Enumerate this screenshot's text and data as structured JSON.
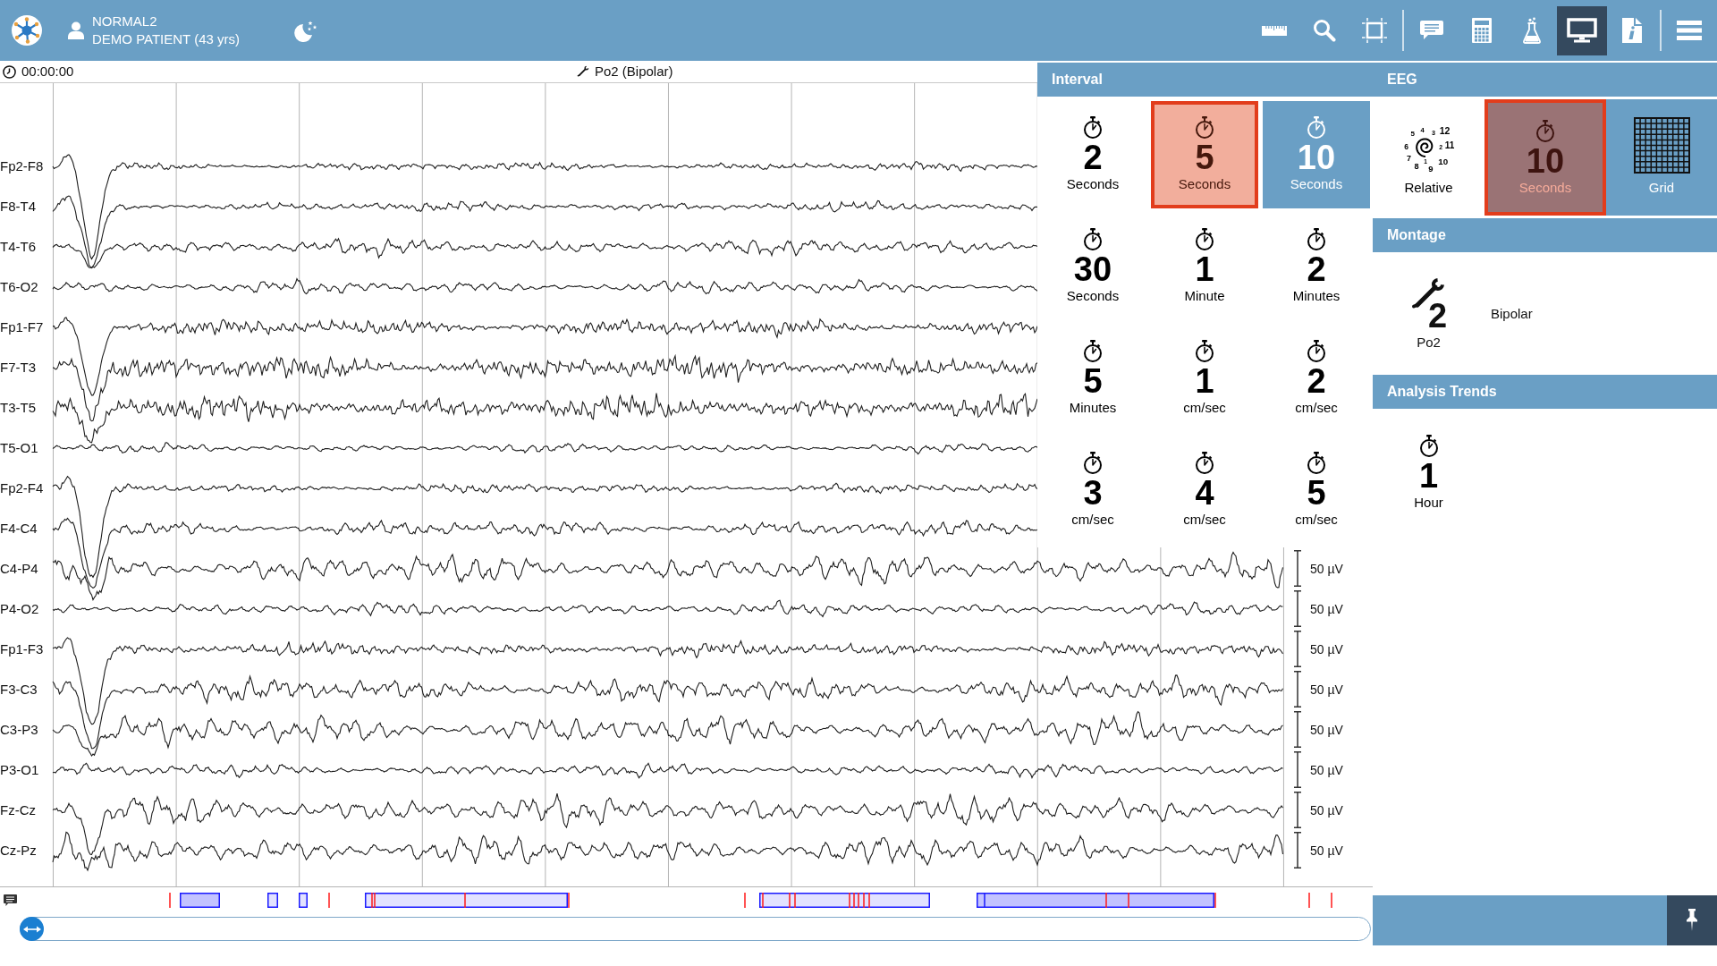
{
  "top_bar": {
    "record_name": "NORMAL2",
    "patient_name": "DEMO PATIENT (43 yrs)",
    "toolbar": [
      {
        "tools": [
          {
            "kind": "ruler",
            "selected": false
          },
          {
            "kind": "search",
            "selected": false
          },
          {
            "kind": "crop",
            "selected": false
          }
        ]
      },
      {
        "tools": [
          {
            "kind": "chat",
            "selected": false
          },
          {
            "kind": "calculator",
            "selected": false
          },
          {
            "kind": "flask",
            "selected": false
          },
          {
            "kind": "monitor",
            "selected": true
          },
          {
            "kind": "info",
            "selected": false
          }
        ]
      },
      {
        "tools": [
          {
            "kind": "menu",
            "selected": false
          }
        ]
      }
    ]
  },
  "eeg_view": {
    "elapsed_time": "00:00:00",
    "montage_title": "Po2 (Bipolar)",
    "channels": [
      {
        "label": "Fp2-F8"
      },
      {
        "label": "F8-T4"
      },
      {
        "label": "T4-T6"
      },
      {
        "label": "T6-O2"
      },
      {
        "label": "Fp1-F7"
      },
      {
        "label": "F7-T3"
      },
      {
        "label": "T3-T5"
      },
      {
        "label": "T5-O1"
      },
      {
        "label": "Fp2-F4"
      },
      {
        "label": "F4-C4"
      },
      {
        "label": "C4-P4",
        "scale": "50 µV"
      },
      {
        "label": "P4-O2",
        "scale": "50 µV"
      },
      {
        "label": "Fp1-F3",
        "scale": "50 µV"
      },
      {
        "label": "F3-C3",
        "scale": "50 µV"
      },
      {
        "label": "C3-P3",
        "scale": "50 µV"
      },
      {
        "label": "P3-O1",
        "scale": "50 µV"
      },
      {
        "label": "Fz-Cz",
        "scale": "50 µV"
      },
      {
        "label": "Cz-Pz",
        "scale": "50 µV"
      }
    ]
  },
  "interval_panel": {
    "title": "Interval",
    "options": [
      {
        "value": "2",
        "unit": "Seconds",
        "selected": false,
        "focused": false
      },
      {
        "value": "5",
        "unit": "Seconds",
        "selected": false,
        "focused": true
      },
      {
        "value": "10",
        "unit": "Seconds",
        "selected": true,
        "focused": false
      },
      {
        "value": "30",
        "unit": "Seconds",
        "selected": false,
        "focused": false
      },
      {
        "value": "1",
        "unit": "Minute",
        "selected": false,
        "focused": false
      },
      {
        "value": "2",
        "unit": "Minutes",
        "selected": false,
        "focused": false
      },
      {
        "value": "5",
        "unit": "Minutes",
        "selected": false,
        "focused": false
      },
      {
        "value": "1",
        "unit": "cm/sec",
        "selected": false,
        "focused": false
      },
      {
        "value": "2",
        "unit": "cm/sec",
        "selected": false,
        "focused": false
      },
      {
        "value": "3",
        "unit": "cm/sec",
        "selected": false,
        "focused": false
      },
      {
        "value": "4",
        "unit": "cm/sec",
        "selected": false,
        "focused": false
      },
      {
        "value": "5",
        "unit": "cm/sec",
        "selected": false,
        "focused": false
      }
    ]
  },
  "eeg_panel": {
    "title": "EEG",
    "options": [
      {
        "kind": "relative",
        "dial_labels": [
          "5",
          "4",
          "3",
          "12",
          "6",
          "2",
          "11",
          "7",
          "1",
          "10",
          "8",
          "9"
        ],
        "label": "Relative",
        "selected": false,
        "focused": false
      },
      {
        "kind": "timer",
        "value": "10",
        "unit": "Seconds",
        "selected": true,
        "focused": true
      },
      {
        "kind": "grid",
        "label": "Grid",
        "selected": true,
        "focused": false
      }
    ]
  },
  "montage_panel": {
    "title": "Montage",
    "value": "2",
    "label": "Po2",
    "description": "Bipolar"
  },
  "analysis_trends_panel": {
    "title": "Analysis Trends",
    "options": [
      {
        "value": "1",
        "unit": "Hour",
        "selected": false,
        "focused": false
      }
    ]
  }
}
